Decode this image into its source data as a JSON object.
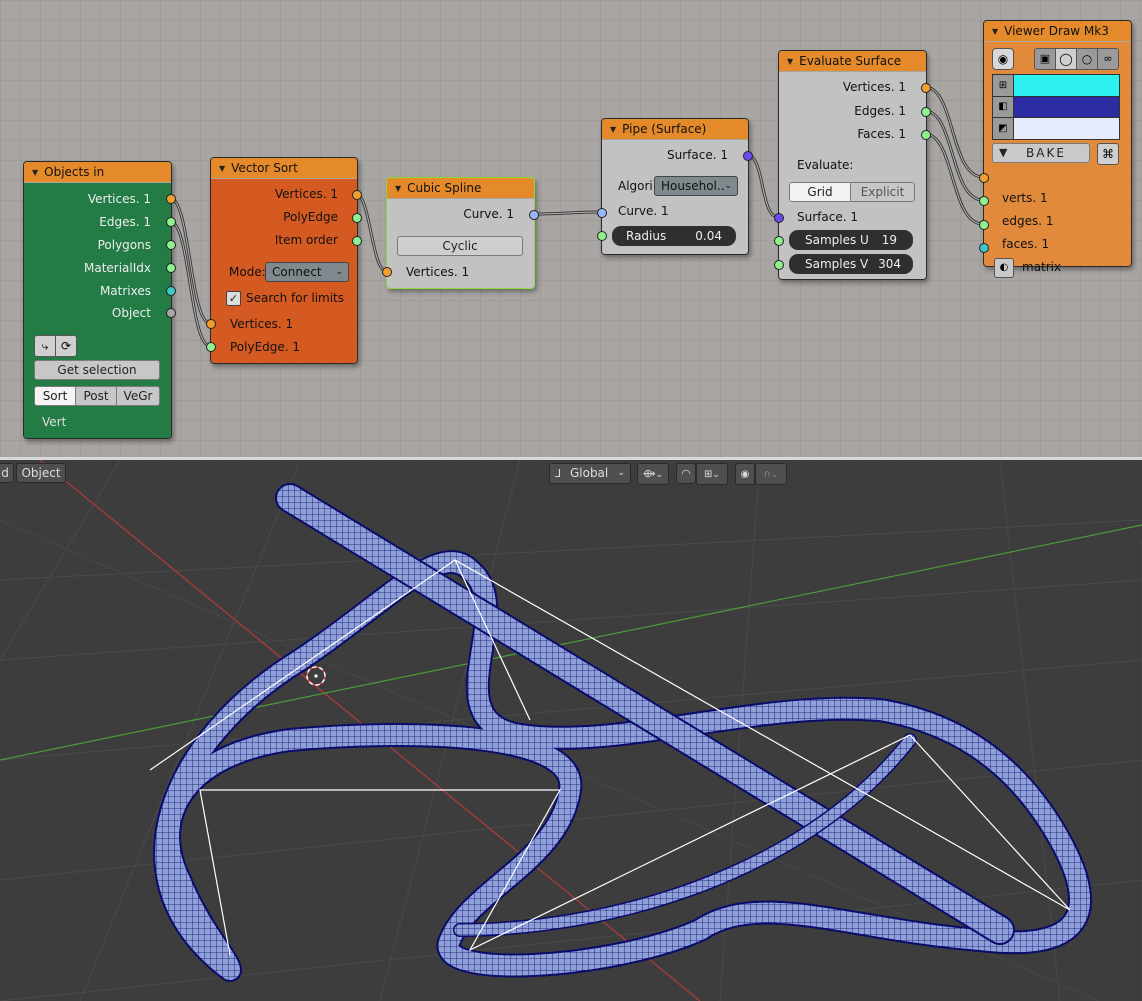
{
  "nodes": {
    "objects_in": {
      "title": "Objects in",
      "outputs": [
        "Vertices. 1",
        "Edges. 1",
        "Polygons",
        "MaterialIdx",
        "Matrixes",
        "Object"
      ],
      "get_selection": "Get selection",
      "tabs": [
        "Sort",
        "Post",
        "VeGr"
      ],
      "active_tab": "Sort",
      "footer": "Vert"
    },
    "vector_sort": {
      "title": "Vector Sort",
      "outputs": [
        "Vertices. 1",
        "PolyEdge",
        "Item order"
      ],
      "mode_label": "Mode:",
      "mode_value": "Connect",
      "search_label": "Search for limits",
      "search_checked": true,
      "inputs": [
        "Vertices. 1",
        "PolyEdge. 1"
      ]
    },
    "cubic_spline": {
      "title": "Cubic Spline",
      "output": "Curve. 1",
      "cyclic": "Cyclic",
      "input": "Vertices. 1"
    },
    "pipe_surface": {
      "title": "Pipe (Surface)",
      "output": "Surface. 1",
      "algori_label": "Algori",
      "algori_value": "Househol..",
      "input_curve": "Curve. 1",
      "radius_label": "Radius",
      "radius_value": "0.04"
    },
    "evaluate_surface": {
      "title": "Evaluate Surface",
      "outputs": [
        "Vertices. 1",
        "Edges. 1",
        "Faces. 1"
      ],
      "evaluate_label": "Evaluate:",
      "modes": [
        "Grid",
        "Explicit"
      ],
      "active_mode": "Grid",
      "input_surface": "Surface. 1",
      "samples_u_label": "Samples U",
      "samples_u_value": "19",
      "samples_v_label": "Samples V",
      "samples_v_value": "304"
    },
    "viewer_draw": {
      "title": "Viewer Draw Mk3",
      "bake": "BAKE",
      "inputs": [
        "verts. 1",
        "edges. 1",
        "faces. 1",
        "matrix"
      ],
      "colors": {
        "verts": "#2df0f0",
        "edges": "#2d2da3",
        "faces": "#e6ecfb"
      }
    }
  },
  "viewport": {
    "mode_left": "d",
    "mode_object": "Object",
    "orientation": "Global"
  },
  "colors": {
    "node_green": "#237b46",
    "node_orange": "#d45a22",
    "node_grey": "#c2c2c2",
    "node_orange_light": "#e18a3c",
    "tube_fill": "#8fa0d8",
    "tube_wire": "#0b0b6b"
  }
}
